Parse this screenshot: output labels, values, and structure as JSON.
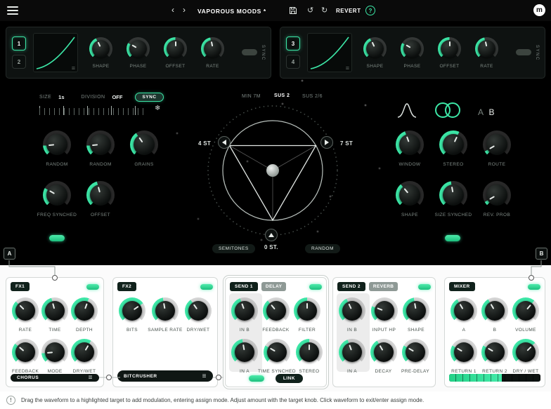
{
  "colors": {
    "accent": "#3ce6a6"
  },
  "icons": {
    "chevron_left": "‹",
    "chevron_right": "›",
    "undo": "↺",
    "redo": "↻",
    "help": "?",
    "logo": "m",
    "grip": "≡",
    "snowflake": "❄",
    "info": "!"
  },
  "topbar": {
    "title": "VAPOROUS MOODS *",
    "revert": "REVERT"
  },
  "lfo": {
    "a": {
      "b1": "1",
      "b2": "2"
    },
    "b": {
      "b1": "3",
      "b2": "4"
    },
    "knobs": [
      "SHAPE",
      "PHASE",
      "OFFSET",
      "RATE"
    ],
    "sync": "SYNC"
  },
  "grain": {
    "size_label": "SIZE",
    "size_value": "1s",
    "division_label": "DIVISION",
    "division_value": "OFF",
    "sync": "SYNC",
    "knobs1": [
      "RANDOM",
      "RANDOM",
      "GRAINS"
    ],
    "knobs2": [
      "FREQ SYNCHED",
      "OFFSET"
    ]
  },
  "pitch": {
    "top1": "MIN 7M",
    "top2": "SUS 2",
    "top3": "SUS 2/6",
    "left": "4 ST",
    "right": "7 ST",
    "bottom": "0 ST.",
    "semitones": "SEMITONES",
    "random": "RANDOM"
  },
  "out": {
    "a": "A",
    "b": "B",
    "knobs1": [
      "WINDOW",
      "STEREO",
      "ROUTE"
    ],
    "knobs2": [
      "SHAPE",
      "SIZE SYNCHED",
      "REV. PROB"
    ]
  },
  "mod": {
    "a": "A",
    "b": "B"
  },
  "fx1": {
    "title": "FX1",
    "knobs1": [
      "RATE",
      "TIME",
      "DEPTH"
    ],
    "knobs2": [
      "FEEDBACK",
      "MODE",
      "DRY/WET"
    ],
    "selector": "CHORUS"
  },
  "fx2": {
    "title": "FX2",
    "knobs1": [
      "BITS",
      "SAMPLE RATE",
      "DRY/WET"
    ],
    "selector": "BITCRUSHER"
  },
  "send1": {
    "title": "SEND 1",
    "tag": "DELAY",
    "knobs1": [
      "IN B",
      "FEEDBACK",
      "FILTER"
    ],
    "knobs2": [
      "IN A",
      "TIME SYNCHED",
      "STEREO"
    ],
    "link": "LINK"
  },
  "send2": {
    "title": "SEND 2",
    "tag": "REVERB",
    "knobs1": [
      "IN B",
      "INPUT HP",
      "SHAPE"
    ],
    "knobs2": [
      "IN A",
      "DECAY",
      "PRE-DELAY"
    ]
  },
  "mixer": {
    "title": "MIXER",
    "knobs1": [
      "A",
      "B",
      "VOLUME"
    ],
    "knobs2": [
      "RETURN 1",
      "RETURN 2",
      "DRY / WET"
    ],
    "meter_percent": 58
  },
  "footer": {
    "text": "Drag the waveform to a highlighted target to add modulation, entering assign mode. Adjust amount with the target knob. Click waveform to exit/enter assign mode."
  }
}
